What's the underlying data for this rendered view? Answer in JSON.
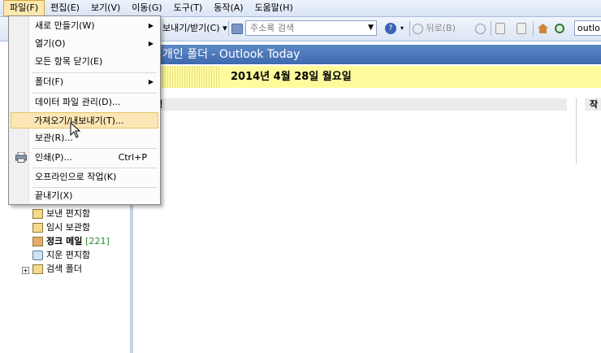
{
  "menubar": {
    "items": [
      "파일(F)",
      "편집(E)",
      "보기(V)",
      "이동(G)",
      "도구(T)",
      "동작(A)",
      "도움말(H)"
    ]
  },
  "toolbar": {
    "send_receive": "보내기/받기(C) ▾",
    "address_book_placeholder": "주소록 검색",
    "back": "뒤로(B)",
    "search_value": "outlo"
  },
  "file_menu": {
    "items": [
      {
        "label": "새로 만들기(W)",
        "submenu": true
      },
      {
        "label": "열기(O)",
        "submenu": true
      },
      {
        "label": "모든 항목 닫기(E)"
      },
      {
        "label": "폴더(F)",
        "submenu": true
      },
      {
        "label": "데이터 파일 관리(D)..."
      },
      {
        "label": "가져오기/내보내기(T)...",
        "highlighted": true
      },
      {
        "label": "보관(R)..."
      },
      {
        "label": "인쇄(P)...",
        "shortcut": "Ctrl+P"
      },
      {
        "label": "오프라인으로 작업(K)"
      },
      {
        "label": "끝내기(X)"
      }
    ]
  },
  "nav": {
    "folders": [
      {
        "name": "보낸 편지함"
      },
      {
        "name": "임시 보관함"
      },
      {
        "name": "정크 메일",
        "count": "[221]",
        "bold": true
      },
      {
        "name": "지운 편지함"
      },
      {
        "name": "검색 폴더",
        "expandable": true
      }
    ]
  },
  "main": {
    "header": "개인 폴더 - Outlook Today",
    "date": "2014년 4월 28일 월요일",
    "columns": [
      "일정",
      "작"
    ]
  },
  "colors": {
    "header_blue": "#3d69ae",
    "date_band": "#fffb9c",
    "menu_highlight": "#fbe7b5"
  }
}
